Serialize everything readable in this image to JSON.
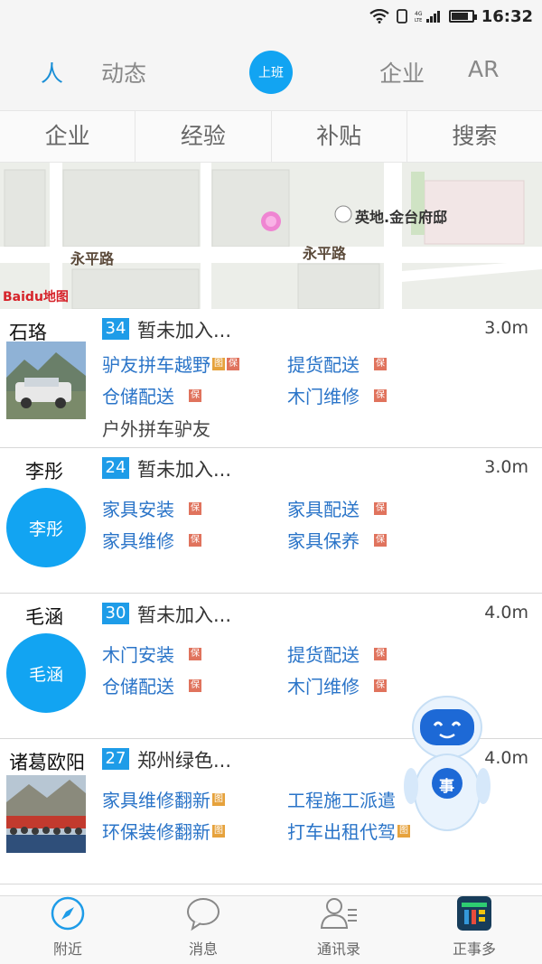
{
  "status_bar": {
    "network": "4G LTE",
    "time": "16:32",
    "battery_level": 0.85
  },
  "top_nav": {
    "tabs": [
      {
        "label": "人",
        "active": true
      },
      {
        "label": "动态",
        "active": false
      },
      {
        "label": "企业",
        "active": false
      },
      {
        "label": "AR",
        "active": false
      }
    ],
    "center_button": "上班"
  },
  "sub_tabs": [
    "企业",
    "经验",
    "补贴",
    "搜索"
  ],
  "map": {
    "roads": [
      "永平路",
      "永平路"
    ],
    "poi": "英地.金台府邸",
    "logo": "Baidu地图"
  },
  "people": [
    {
      "name": "石珞",
      "avatar_type": "photo-car",
      "age": "34",
      "company": "暂未加入...",
      "distance": "3.0m",
      "services": [
        {
          "label": "驴友拼车越野",
          "tags": [
            "图",
            "保"
          ]
        },
        {
          "label": "提货配送",
          "tags": [
            "保"
          ]
        },
        {
          "label": "仓储配送",
          "tags": [
            "保"
          ]
        },
        {
          "label": "木门维修",
          "tags": [
            "保"
          ]
        },
        {
          "label": "户外拼车驴友",
          "tags": [],
          "plain": true
        }
      ]
    },
    {
      "name": "李彤",
      "avatar_type": "initials",
      "avatar_text": "李彤",
      "age": "24",
      "company": "暂未加入...",
      "distance": "3.0m",
      "services": [
        {
          "label": "家具安装",
          "tags": [
            "保"
          ]
        },
        {
          "label": "家具配送",
          "tags": [
            "保"
          ]
        },
        {
          "label": "家具维修",
          "tags": [
            "保"
          ]
        },
        {
          "label": "家具保养",
          "tags": [
            "保"
          ]
        }
      ]
    },
    {
      "name": "毛涵",
      "avatar_type": "initials",
      "avatar_text": "毛涵",
      "age": "30",
      "company": "暂未加入...",
      "distance": "4.0m",
      "services": [
        {
          "label": "木门安装",
          "tags": [
            "保"
          ]
        },
        {
          "label": "提货配送",
          "tags": [
            "保"
          ]
        },
        {
          "label": "仓储配送",
          "tags": [
            "保"
          ]
        },
        {
          "label": "木门维修",
          "tags": [
            "保"
          ]
        }
      ]
    },
    {
      "name": "诸葛欧阳",
      "avatar_type": "photo-group",
      "age": "27",
      "company": "郑州绿色...",
      "distance": "4.0m",
      "services": [
        {
          "label": "家具维修翻新",
          "tags": [
            "图"
          ]
        },
        {
          "label": "工程施工派遣",
          "tags": []
        },
        {
          "label": "环保装修翻新",
          "tags": [
            "图"
          ]
        },
        {
          "label": "打车出租代驾",
          "tags": [
            "图"
          ]
        }
      ]
    }
  ],
  "robot_badge": "事",
  "bottom_tabs": [
    {
      "label": "附近",
      "icon": "compass-icon",
      "active": true
    },
    {
      "label": "消息",
      "icon": "chat-bubble-icon",
      "active": false
    },
    {
      "label": "通讯录",
      "icon": "contacts-icon",
      "active": false
    },
    {
      "label": "正事多",
      "icon": "app-logo-icon",
      "active": false
    }
  ],
  "colors": {
    "accent": "#12a4f2",
    "link": "#2a74c8",
    "tag": "#e0735d",
    "tag_img": "#e6a23c"
  }
}
